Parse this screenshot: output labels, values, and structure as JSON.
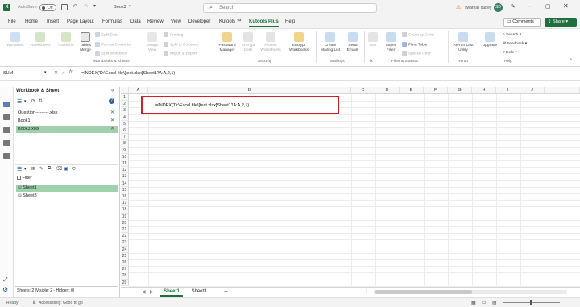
{
  "titlebar": {
    "autosave_label": "AutoSave",
    "autosave_state": "Off",
    "filename": "Book3",
    "search_placeholder": "Search",
    "user_name": "swarnali dubey",
    "user_initials": "SD"
  },
  "menu": {
    "items": [
      "File",
      "Home",
      "Insert",
      "Page Layout",
      "Formulas",
      "Data",
      "Review",
      "View",
      "Developer",
      "Kutools ™",
      "Kutools Plus",
      "Help"
    ],
    "active": "Kutools Plus",
    "comments": "Comments",
    "share": "Share"
  },
  "ribbon": {
    "workbook": "Workbook",
    "worksheets": "Worksheets",
    "combine": "Combine",
    "tables_merge": "Tables Merge",
    "split_data": "Split Data",
    "format_converter": "Format Converter",
    "split_workbook": "Split Workbook",
    "design_view": "Design View",
    "printing": "Printing",
    "split_to_columns": "Split to Columns",
    "import_export": "Import & Export",
    "password_manager": "Password Manager",
    "encrypt_cells": "Encrypt Cells",
    "protect_worksheets": "Protect Worksheets",
    "encrypt_workbooks": "Encrypt Workbooks",
    "create_mailing_list": "Create Mailing List",
    "send_emails": "Send Emails",
    "sort": "Sort",
    "super_filter": "Super Filter",
    "count_by_color": "Count by Color",
    "pivot_table": "Pivot Table",
    "special_filter": "Special Filter",
    "rerun_utility": "Re-run Last Utility",
    "upgrade": "Upgrade",
    "search": "Search",
    "feedback": "Feedback",
    "help": "Help",
    "group_workbooks_sheets": "Workbooks & Sheets",
    "group_security": "Security",
    "group_mailings": "Mailings",
    "group_fx": "fx",
    "group_filter_statistic": "Filter & Statistic",
    "group_rerun": "Rerun",
    "group_help": "Help"
  },
  "formula_bar": {
    "name_box": "SUM",
    "fx": "fx",
    "formula": "=INDEX('D:\\Excel file\\[test.xlsx]Sheet1'!A:A,2,1)"
  },
  "pane": {
    "title": "Workbook & Sheet",
    "workbooks": [
      {
        "name": "Question---------.xlsx",
        "selected": false
      },
      {
        "name": "Book1",
        "selected": false
      },
      {
        "name": "Book3.xlsx",
        "selected": true
      }
    ],
    "filter_label": "Filter",
    "sheets": [
      {
        "name": "Sheet1",
        "selected": true
      },
      {
        "name": "Sheet3",
        "selected": false
      }
    ],
    "footer": "Sheets: 2  |Visible: 2 - Hidden: 0|"
  },
  "grid": {
    "columns": [
      "A",
      "B",
      "C",
      "D",
      "E",
      "F",
      "G",
      "H",
      "I",
      "J"
    ],
    "rows": [
      "1",
      "2",
      "3",
      "4",
      "5",
      "6",
      "7",
      "8",
      "9",
      "10",
      "11",
      "12",
      "13",
      "14",
      "15",
      "16",
      "17",
      "18",
      "19",
      "20",
      "21",
      "22",
      "23",
      "24",
      "25",
      "26",
      "27",
      "28",
      "29"
    ],
    "active_cell_text": "=INDEX('D:\\Excel file\\[test.xlsx]Sheet1'!A:A,2,1)"
  },
  "sheet_tabs": {
    "tabs": [
      "Sheet1",
      "Sheet3"
    ],
    "active": "Sheet1",
    "add": "+"
  },
  "status": {
    "ready": "Ready",
    "accessibility": "Accessibility: Good to go"
  },
  "colors": {
    "accent": "#1e6e3e",
    "highlight": "#c0c0c0",
    "red_outline": "#d0202a",
    "selected_row": "#9fd1ad"
  }
}
